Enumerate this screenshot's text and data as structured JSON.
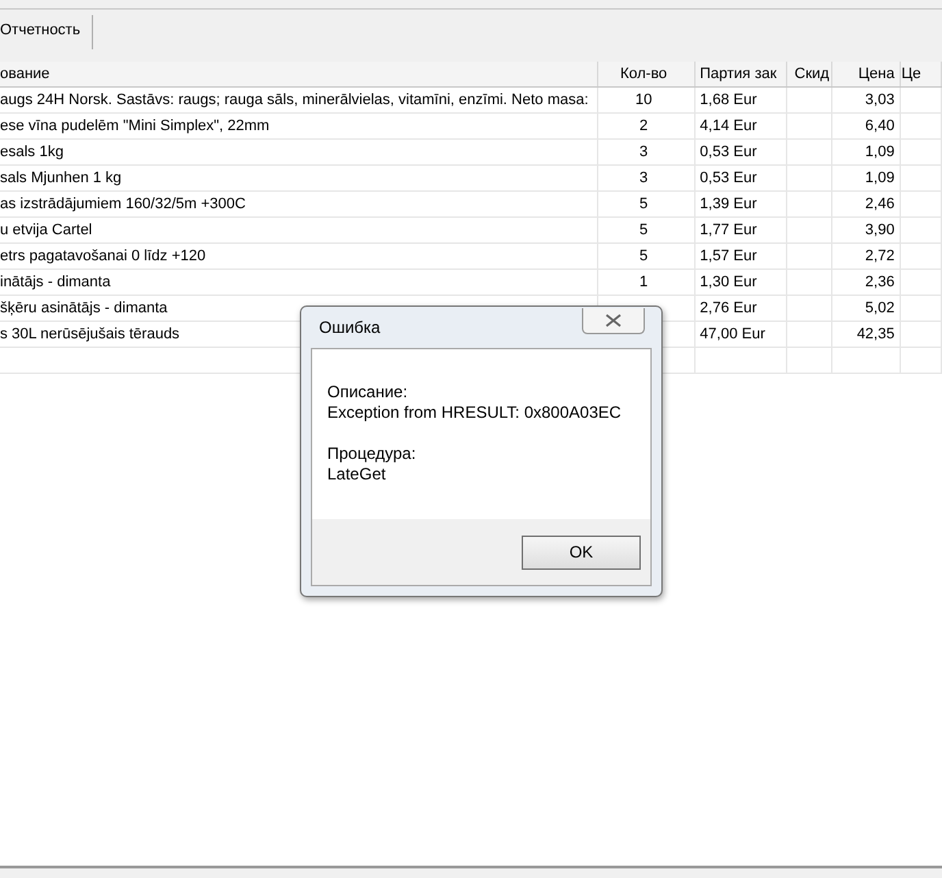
{
  "tabs": [
    {
      "label": "Отчетность",
      "selected": true
    }
  ],
  "table": {
    "columns": [
      "ование",
      "Кол-во",
      "Партия зак",
      "Скид",
      "Цена",
      "Це"
    ],
    "rows": [
      {
        "name": "augs 24H Norsk. Sastāvs: raugs; rauga sāls, minerālvielas, vitamīni, enzīmi. Neto masa:",
        "qty": "10",
        "batch": "1,68 Eur",
        "price": "3,03"
      },
      {
        "name": "ese vīna pudelēm \"Mini Simplex\", 22mm",
        "qty": "2",
        "batch": "4,14 Eur",
        "price": "6,40"
      },
      {
        "name": "esals 1kg",
        "qty": "3",
        "batch": "0,53 Eur",
        "price": "1,09"
      },
      {
        "name": "sals Mjunhen 1 kg",
        "qty": "3",
        "batch": "0,53 Eur",
        "price": "1,09"
      },
      {
        "name": "as izstrādājumiem 160/32/5m +300C",
        "qty": "5",
        "batch": "1,39 Eur",
        "price": "2,46"
      },
      {
        "name": "u etvija Cartel",
        "qty": "5",
        "batch": "1,77 Eur",
        "price": "3,90"
      },
      {
        "name": "etrs pagatavošanai 0 līdz +120",
        "qty": "5",
        "batch": "1,57 Eur",
        "price": "2,72"
      },
      {
        "name": "inātājs - dimanta",
        "qty": "1",
        "batch": "1,30 Eur",
        "price": "2,36"
      },
      {
        "name": "šķēru asinātājs - dimanta",
        "batch": "2,76 Eur",
        "price": "5,02"
      },
      {
        "name": "s 30L nerūsējušais tērauds",
        "batch": "47,00 Eur",
        "price": "42,35"
      }
    ]
  },
  "dialog": {
    "title": "Ошибка",
    "paragraphs": [
      [
        "Описание:",
        "Exception from HRESULT: 0x800A03EC"
      ],
      [
        "Процедура:",
        "LateGet"
      ]
    ],
    "button": "OK"
  }
}
